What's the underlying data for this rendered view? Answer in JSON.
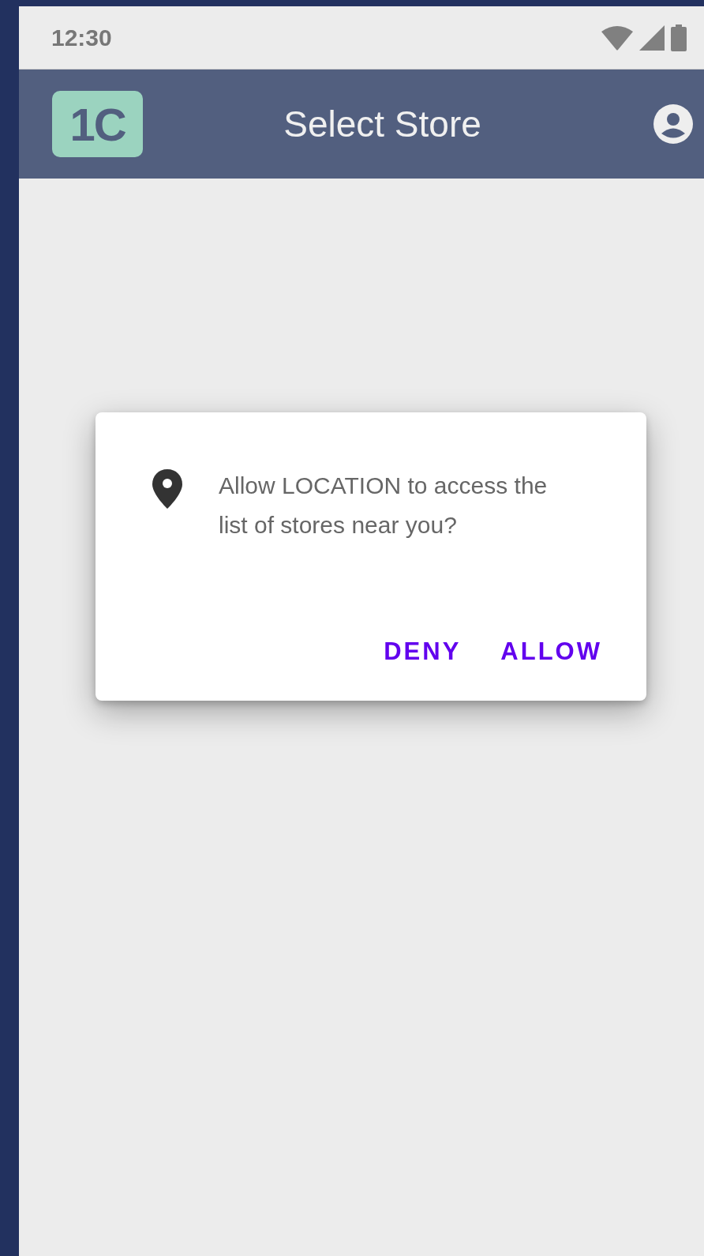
{
  "status_bar": {
    "time": "12:30"
  },
  "app_bar": {
    "logo": "1C",
    "title": "Select Store"
  },
  "dialog": {
    "message": "Allow LOCATION to access the list of stores near you?",
    "buttons": [
      "DENY",
      "ALLOW"
    ]
  }
}
